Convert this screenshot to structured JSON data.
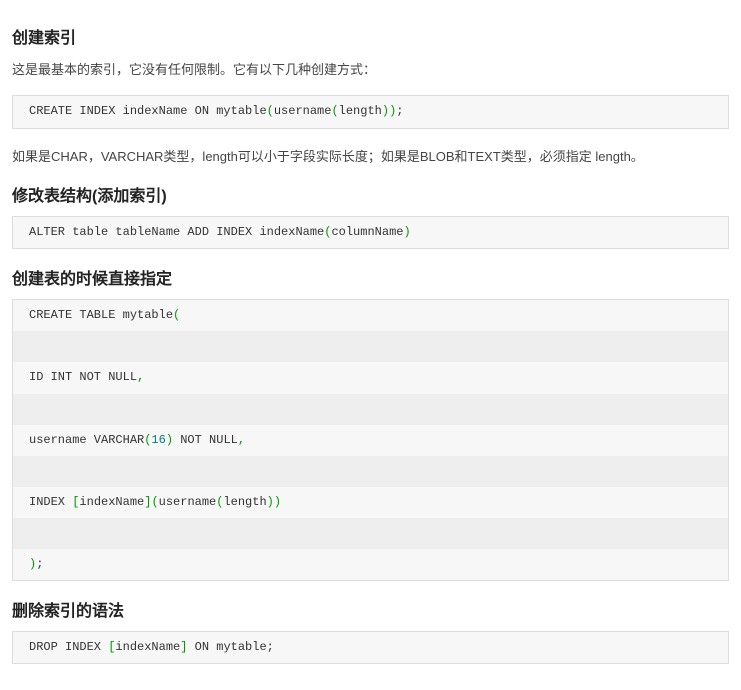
{
  "sections": {
    "s1": {
      "heading": "创建索引",
      "intro": "这是最基本的索引，它没有任何限制。它有以下几种创建方式：",
      "code_lines": [
        "CREATE INDEX indexName ON mytable|(|username|(|length|))|;"
      ],
      "note": "如果是CHAR，VARCHAR类型，length可以小于字段实际长度；如果是BLOB和TEXT类型，必须指定 length。"
    },
    "s2": {
      "heading": "修改表结构(添加索引)",
      "code_lines": [
        "ALTER table tableName ADD INDEX indexName|(|columnName|)|"
      ]
    },
    "s3": {
      "heading": "创建表的时候直接指定",
      "code_lines": [
        "CREATE TABLE mytable|(|  ",
        " ",
        "ID INT NOT NULL|,|   ",
        " ",
        "username VARCHAR|(|#16#|)| NOT NULL|,|  ",
        " ",
        "INDEX |[|indexName|]| |(|username|(|length|))|  ",
        " ",
        "|)|;  "
      ]
    },
    "s4": {
      "heading": "删除索引的语法",
      "code_lines": [
        "DROP INDEX |[|indexName|]| ON mytable; "
      ]
    }
  }
}
